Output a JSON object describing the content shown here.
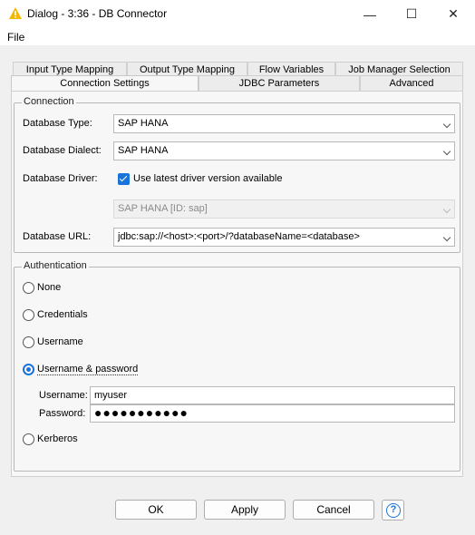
{
  "window": {
    "title": "Dialog - 3:36 - DB Connector",
    "minimize": "—",
    "maximize": "☐",
    "close": "✕"
  },
  "menu": {
    "file": "File"
  },
  "tabs": {
    "row1": [
      "Input Type Mapping",
      "Output Type Mapping",
      "Flow Variables",
      "Job Manager Selection"
    ],
    "row2": [
      "Connection Settings",
      "JDBC Parameters",
      "Advanced"
    ],
    "active": "Connection Settings"
  },
  "connection": {
    "legend": "Connection",
    "db_type_label": "Database Type:",
    "db_type_value": "SAP HANA",
    "dialect_label": "Database Dialect:",
    "dialect_value": "SAP HANA",
    "driver_label": "Database Driver:",
    "latest_driver_label": "Use latest driver version available",
    "latest_driver_checked": true,
    "driver_value": "SAP HANA [ID: sap]",
    "url_label": "Database URL:",
    "url_value": "jdbc:sap://<host>:<port>/?databaseName=<database>"
  },
  "authentication": {
    "legend": "Authentication",
    "options": [
      "None",
      "Credentials",
      "Username",
      "Username & password",
      "Kerberos"
    ],
    "selected": "Username & password",
    "username_label": "Username:",
    "username_value": "myuser",
    "password_label": "Password:",
    "password_value": "●●●●●●●●●●●"
  },
  "buttons": {
    "ok": "OK",
    "apply": "Apply",
    "cancel": "Cancel",
    "help": "?"
  },
  "colors": {
    "accent": "#1a73d9",
    "icon": "#f5b800"
  }
}
